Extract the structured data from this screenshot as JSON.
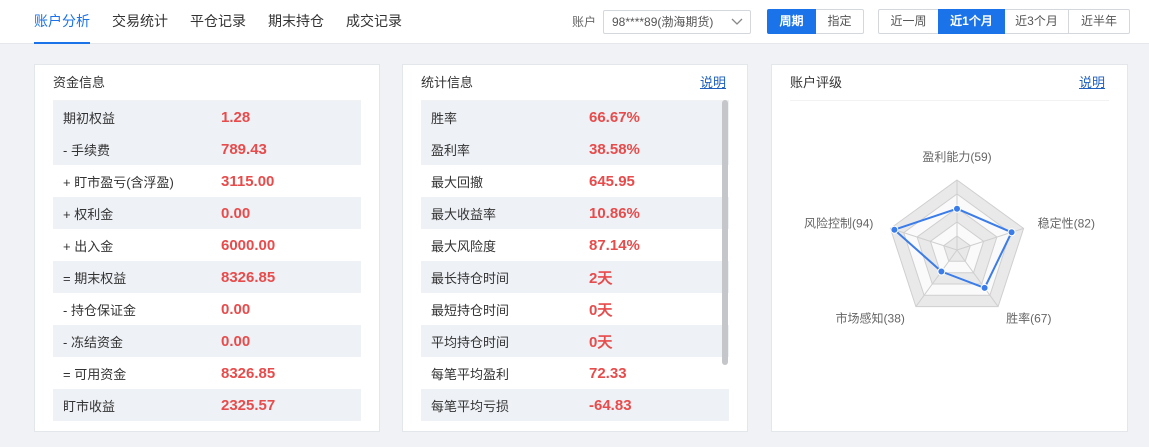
{
  "colors": {
    "accent": "#1a73e8",
    "value_text": "#e84b4b",
    "link": "#1f5fbf",
    "radar_line": "#3a7ce9"
  },
  "tabs": [
    {
      "label": "账户分析",
      "active": true
    },
    {
      "label": "交易统计",
      "active": false
    },
    {
      "label": "平仓记录",
      "active": false
    },
    {
      "label": "期末持仓",
      "active": false
    },
    {
      "label": "成交记录",
      "active": false
    }
  ],
  "account": {
    "label": "账户",
    "selected": "98****89(渤海期货)"
  },
  "period_mode": {
    "options": [
      {
        "label": "周期",
        "active": true
      },
      {
        "label": "指定",
        "active": false
      }
    ]
  },
  "range": {
    "options": [
      {
        "label": "近一周",
        "active": false
      },
      {
        "label": "近1个月",
        "active": true
      },
      {
        "label": "近3个月",
        "active": false
      },
      {
        "label": "近半年",
        "active": false
      }
    ]
  },
  "funds": {
    "title": "资金信息",
    "rows": [
      {
        "label": "期初权益",
        "value": "1.28"
      },
      {
        "label": "- 手续费",
        "value": "789.43"
      },
      {
        "label": "+ 盯市盈亏(含浮盈)",
        "value": "3115.00"
      },
      {
        "label": "+ 权利金",
        "value": "0.00"
      },
      {
        "label": "+ 出入金",
        "value": "6000.00"
      },
      {
        "label": "= 期末权益",
        "value": "8326.85"
      },
      {
        "label": "- 持仓保证金",
        "value": "0.00"
      },
      {
        "label": "- 冻结资金",
        "value": "0.00"
      },
      {
        "label": "= 可用资金",
        "value": "8326.85"
      },
      {
        "label": "盯市收益",
        "value": "2325.57"
      }
    ]
  },
  "stats": {
    "title": "统计信息",
    "help": "说明",
    "rows": [
      {
        "label": "胜率",
        "value": "66.67%"
      },
      {
        "label": "盈利率",
        "value": "38.58%"
      },
      {
        "label": "最大回撤",
        "value": "645.95"
      },
      {
        "label": "最大收益率",
        "value": "10.86%"
      },
      {
        "label": "最大风险度",
        "value": "87.14%"
      },
      {
        "label": "最长持仓时间",
        "value": "2天"
      },
      {
        "label": "最短持仓时间",
        "value": "0天"
      },
      {
        "label": "平均持仓时间",
        "value": "0天"
      },
      {
        "label": "每笔平均盈利",
        "value": "72.33"
      },
      {
        "label": "每笔平均亏损",
        "value": "-64.83"
      }
    ]
  },
  "rating": {
    "title": "账户评级",
    "help": "说明"
  },
  "chart_data": {
    "type": "radar",
    "labels": [
      "盈利能力(59)",
      "稳定性(82)",
      "胜率(67)",
      "市场感知(38)",
      "风险控制(94)"
    ],
    "values": [
      59,
      82,
      67,
      38,
      94
    ],
    "max": 100,
    "grid": true
  }
}
